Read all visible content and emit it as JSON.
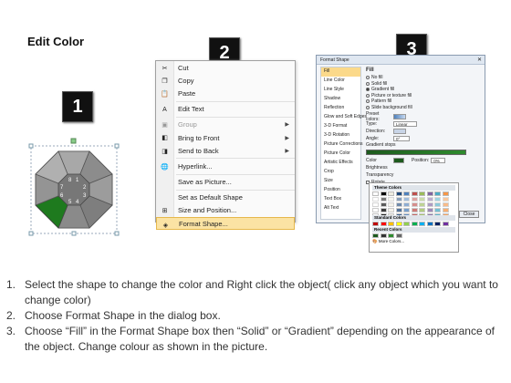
{
  "title": "Edit Color",
  "steps": [
    "1",
    "2",
    "3"
  ],
  "octagon_labels": [
    "8",
    "1",
    "7",
    "2",
    "3",
    "6",
    "4",
    "5"
  ],
  "context_menu": {
    "items": [
      {
        "label": "Cut",
        "icon": "scissors-icon",
        "disabled": false,
        "arrow": false
      },
      {
        "label": "Copy",
        "icon": "copy-icon",
        "disabled": false,
        "arrow": false
      },
      {
        "label": "Paste",
        "icon": "paste-icon",
        "disabled": false,
        "arrow": false
      },
      {
        "label": "Edit Text",
        "icon": "edit-text-icon",
        "disabled": false,
        "arrow": false
      },
      {
        "label": "Group",
        "icon": "group-icon",
        "disabled": true,
        "arrow": true
      },
      {
        "label": "Bring to Front",
        "icon": "bring-front-icon",
        "disabled": false,
        "arrow": true
      },
      {
        "label": "Send to Back",
        "icon": "send-back-icon",
        "disabled": false,
        "arrow": true
      },
      {
        "label": "Hyperlink...",
        "icon": "hyperlink-icon",
        "disabled": false,
        "arrow": false
      },
      {
        "label": "Save as Picture...",
        "icon": "",
        "disabled": false,
        "arrow": false
      },
      {
        "label": "Set as Default Shape",
        "icon": "",
        "disabled": false,
        "arrow": false
      },
      {
        "label": "Size and Position...",
        "icon": "size-icon",
        "disabled": false,
        "arrow": false
      },
      {
        "label": "Format Shape...",
        "icon": "format-shape-icon",
        "disabled": false,
        "arrow": false
      }
    ]
  },
  "dialog": {
    "title": "Format Shape",
    "close_glyph": "✕",
    "sidebar": [
      "Fill",
      "Line Color",
      "Line Style",
      "Shadow",
      "Reflection",
      "Glow and Soft Edges",
      "3-D Format",
      "3-D Rotation",
      "Picture Corrections",
      "Picture Color",
      "Artistic Effects",
      "Crop",
      "Size",
      "Position",
      "Text Box",
      "Alt Text"
    ],
    "section_label": "Fill",
    "fill_options": [
      "No fill",
      "Solid fill",
      "Gradient fill",
      "Picture or texture fill",
      "Pattern fill",
      "Slide background fill"
    ],
    "selected_fill": 2,
    "preset_label": "Preset colors:",
    "type_label": "Type:",
    "type_value": "Linear",
    "direction_label": "Direction:",
    "angle_label": "Angle:",
    "angle_value": "0°",
    "stops_label": "Gradient stops",
    "color_label": "Color",
    "position_label": "Position:",
    "position_value": "0%",
    "brightness_label": "Brightness",
    "transparency_label": "Transparency",
    "rotate_label": "Rotate",
    "close_label": "Close"
  },
  "palette": {
    "theme_label": "Theme Colors",
    "standard_label": "Standard Colors",
    "recent_label": "Recent Colors",
    "more_label": "More Colors...",
    "theme_top": [
      "#ffffff",
      "#000000",
      "#eeece1",
      "#1f497d",
      "#4f81bd",
      "#c0504d",
      "#9bbb59",
      "#8064a2",
      "#4bacc6",
      "#f79646"
    ],
    "standard": [
      "#c00000",
      "#ff0000",
      "#ffc000",
      "#ffff00",
      "#92d050",
      "#00b050",
      "#00b0f0",
      "#0070c0",
      "#002060",
      "#7030a0"
    ],
    "recent": [
      "#1d5a1d",
      "#333333",
      "#2e8b2e",
      "#666666"
    ]
  },
  "instructions": [
    {
      "n": "1.",
      "text": "Select the shape to change the color and Right click the object( click any object which you want to change color)"
    },
    {
      "n": "2.",
      "text": "Choose Format Shape in the dialog box."
    },
    {
      "n": "3.",
      "text": "Choose “Fill” in the Format Shape box then “Solid” or “Gradient” depending on the appearance of the object. Change colour as shown in the picture."
    }
  ]
}
